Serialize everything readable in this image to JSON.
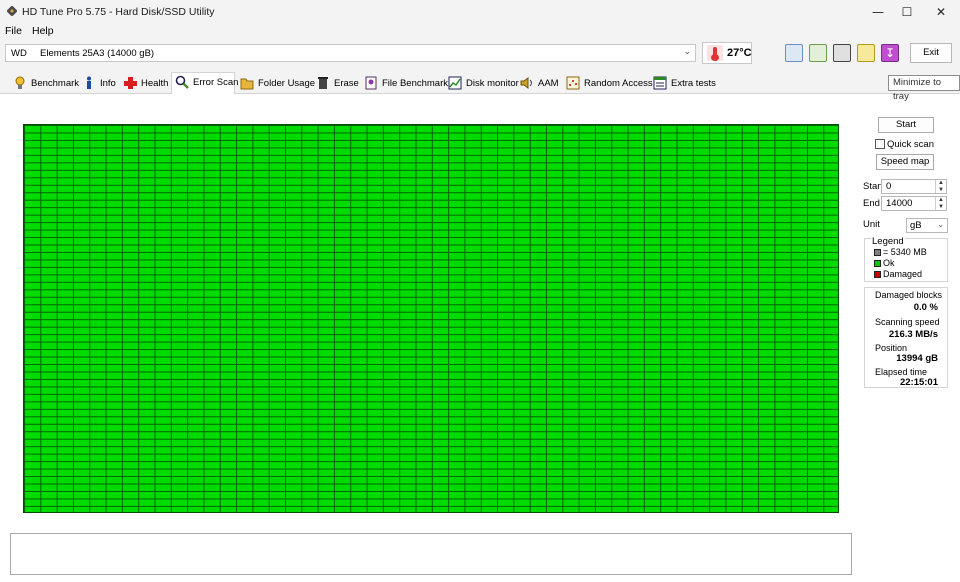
{
  "window": {
    "title": "HD Tune Pro 5.75 - Hard Disk/SSD Utility",
    "minimize_glyph": "—",
    "maximize_glyph": "☐",
    "close_glyph": "✕"
  },
  "menu": {
    "file": "File",
    "help": "Help"
  },
  "toolbar": {
    "drive_brand": "WD",
    "drive_name": "Elements 25A3 (14000 gB)",
    "temperature": "27°C",
    "exit_label": "Exit",
    "tooltip": "Minimize to tray",
    "icons": [
      "copy-text-icon",
      "copy-screenshot-icon",
      "camera-icon",
      "options-icon",
      "minimize-to-tray-icon"
    ]
  },
  "tabs": [
    {
      "label": "Benchmark",
      "icon": "lightbulb-icon"
    },
    {
      "label": "Info",
      "icon": "info-icon"
    },
    {
      "label": "Health",
      "icon": "health-cross-icon"
    },
    {
      "label": "Error Scan",
      "icon": "magnifier-icon",
      "active": true
    },
    {
      "label": "Folder Usage",
      "icon": "folder-icon"
    },
    {
      "label": "Erase",
      "icon": "trash-icon"
    },
    {
      "label": "File Benchmark",
      "icon": "file-benchmark-icon"
    },
    {
      "label": "Disk monitor",
      "icon": "disk-monitor-icon"
    },
    {
      "label": "AAM",
      "icon": "speaker-icon"
    },
    {
      "label": "Random Access",
      "icon": "random-access-icon"
    },
    {
      "label": "Extra tests",
      "icon": "extra-tests-icon"
    }
  ],
  "scan": {
    "columns": 50,
    "rows": 52,
    "block_status": "ok"
  },
  "panel": {
    "start_button": "Start",
    "quick_scan_label": "Quick scan",
    "quick_scan_checked": false,
    "speed_map_button": "Speed map",
    "start_label": "Start",
    "start_value": "0",
    "end_label": "End",
    "end_value": "14000",
    "unit_label": "Unit",
    "unit_value": "gB"
  },
  "legend": {
    "title": "Legend",
    "items": [
      {
        "label": "= 5340 MB",
        "color": "#808080"
      },
      {
        "label": "Ok",
        "color": "#00cc00"
      },
      {
        "label": "Damaged",
        "color": "#cc0000"
      }
    ]
  },
  "stats": {
    "damaged_label": "Damaged blocks",
    "damaged_value": "0.0 %",
    "speed_label": "Scanning speed",
    "speed_value": "216.3 MB/s",
    "position_label": "Position",
    "position_value": "13994 gB",
    "elapsed_label": "Elapsed time",
    "elapsed_value": "22:15:01"
  },
  "colors": {
    "ok_block": "#00dc00",
    "grid_line": "#006400"
  }
}
